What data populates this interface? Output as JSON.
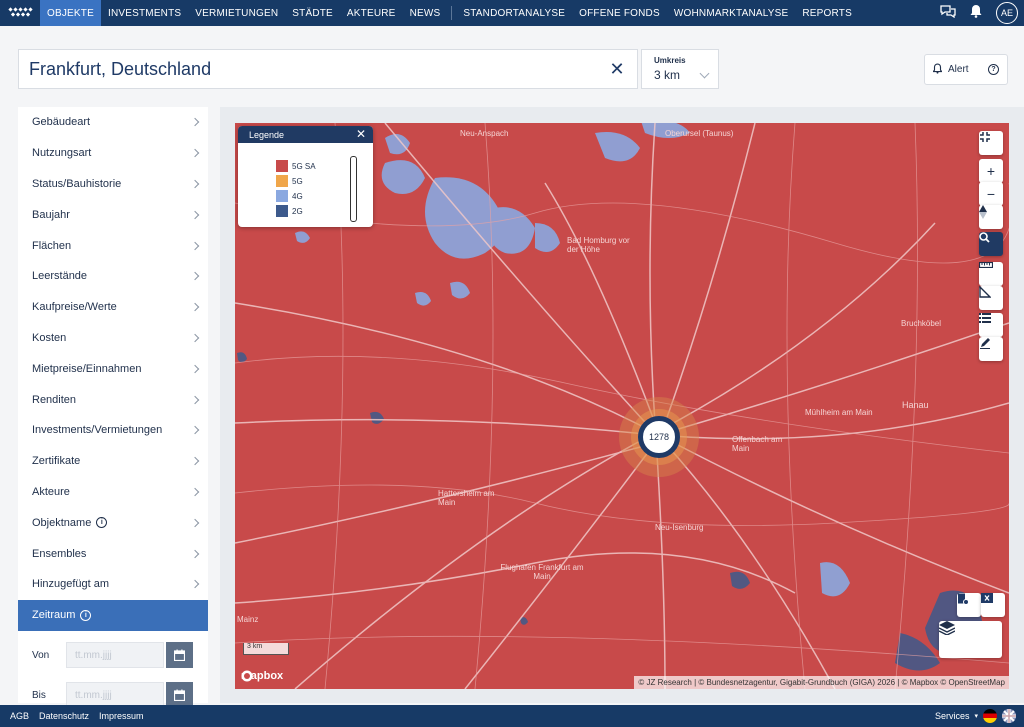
{
  "nav": {
    "items": [
      "OBJEKTE",
      "INVESTMENTS",
      "VERMIETUNGEN",
      "STÄDTE",
      "AKTEURE",
      "NEWS"
    ],
    "items2": [
      "STANDORTANALYSE",
      "OFFENE FONDS",
      "WOHNMARKTANALYSE",
      "REPORTS"
    ],
    "avatar": "AE"
  },
  "search": {
    "value": "Frankfurt, Deutschland",
    "clear": "✕"
  },
  "umkreis": {
    "label": "Umkreis",
    "value": "3 km"
  },
  "alert": {
    "label": "Alert"
  },
  "sidebar": {
    "items": [
      "Gebäudeart",
      "Nutzungsart",
      "Status/Bauhistorie",
      "Baujahr",
      "Flächen",
      "Leerstände",
      "Kaufpreise/Werte",
      "Kosten",
      "Mietpreise/Einnahmen",
      "Renditen",
      "Investments/Vermietungen",
      "Zertifikate",
      "Akteure",
      "Objektname",
      "Ensembles",
      "Hinzugefügt am"
    ],
    "active": "Zeitraum",
    "von_label": "Von",
    "bis_label": "Bis",
    "date_placeholder": "tt.mm.jjjj"
  },
  "legend": {
    "title": "Legende",
    "entries": [
      {
        "label": "5G SA",
        "color": "#c84a4a"
      },
      {
        "label": "5G",
        "color": "#f0a64a"
      },
      {
        "label": "4G",
        "color": "#8aa8e0"
      },
      {
        "label": "2G",
        "color": "#3d5a8c"
      }
    ]
  },
  "map": {
    "cluster_count": "1278",
    "scale": "3 km",
    "mapbox": "mapbox",
    "attribution": "© JZ Research | © Bundesnetzagentur, Gigabit-Grundbuch (GIGA) 2026 | © Mapbox © OpenStreetMap",
    "places": [
      {
        "name": "Neu-Anspach"
      },
      {
        "name": "Oberursel (Taunus)"
      },
      {
        "name": "Bad Homburg vor der Höhe"
      },
      {
        "name": "Bruchköbel"
      },
      {
        "name": "Mühlheim am Main"
      },
      {
        "name": "Offenbach am Main"
      },
      {
        "name": "Hanau"
      },
      {
        "name": "Hattersheim am Main"
      },
      {
        "name": "Neu-Isenburg"
      },
      {
        "name": "Flughafen Frankfurt am Main"
      },
      {
        "name": "Mainz"
      }
    ]
  },
  "footer": {
    "links": [
      "AGB",
      "Datenschutz",
      "Impressum"
    ],
    "services": "Services"
  }
}
